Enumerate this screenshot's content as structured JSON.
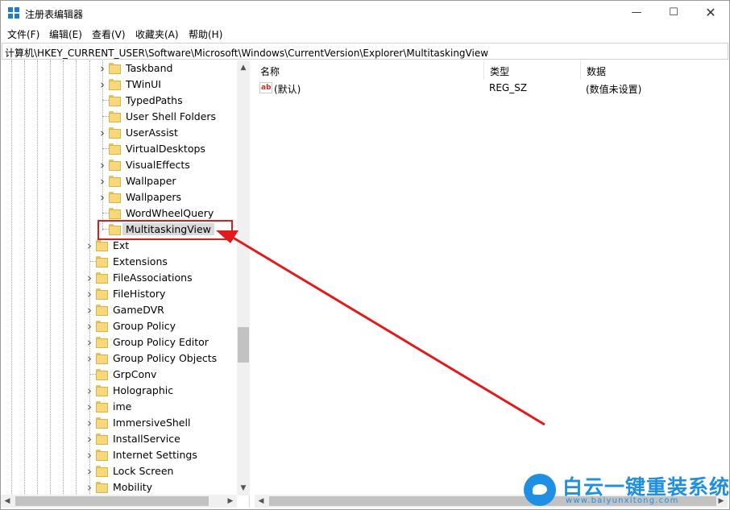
{
  "window": {
    "title": "注册表编辑器"
  },
  "menu": [
    "文件(F)",
    "编辑(E)",
    "查看(V)",
    "收藏夹(A)",
    "帮助(H)"
  ],
  "address": "计算机\\HKEY_CURRENT_USER\\Software\\Microsoft\\Windows\\CurrentVersion\\Explorer\\MultitaskingView",
  "tree": [
    {
      "label": "Taskband",
      "expandable": true,
      "level": 2
    },
    {
      "label": "TWinUI",
      "expandable": true,
      "level": 2
    },
    {
      "label": "TypedPaths",
      "expandable": false,
      "level": 2
    },
    {
      "label": "User Shell Folders",
      "expandable": false,
      "level": 2
    },
    {
      "label": "UserAssist",
      "expandable": true,
      "level": 2
    },
    {
      "label": "VirtualDesktops",
      "expandable": false,
      "level": 2
    },
    {
      "label": "VisualEffects",
      "expandable": true,
      "level": 2
    },
    {
      "label": "Wallpaper",
      "expandable": true,
      "level": 2
    },
    {
      "label": "Wallpapers",
      "expandable": true,
      "level": 2
    },
    {
      "label": "WordWheelQuery",
      "expandable": false,
      "level": 2
    },
    {
      "label": "MultitaskingView",
      "expandable": false,
      "level": 2,
      "selected": true
    },
    {
      "label": "Ext",
      "expandable": true,
      "level": 1
    },
    {
      "label": "Extensions",
      "expandable": false,
      "level": 1
    },
    {
      "label": "FileAssociations",
      "expandable": true,
      "level": 1
    },
    {
      "label": "FileHistory",
      "expandable": true,
      "level": 1
    },
    {
      "label": "GameDVR",
      "expandable": true,
      "level": 1
    },
    {
      "label": "Group Policy",
      "expandable": true,
      "level": 1
    },
    {
      "label": "Group Policy Editor",
      "expandable": true,
      "level": 1
    },
    {
      "label": "Group Policy Objects",
      "expandable": true,
      "level": 1
    },
    {
      "label": "GrpConv",
      "expandable": false,
      "level": 1
    },
    {
      "label": "Holographic",
      "expandable": true,
      "level": 1
    },
    {
      "label": "ime",
      "expandable": true,
      "level": 1
    },
    {
      "label": "ImmersiveShell",
      "expandable": true,
      "level": 1
    },
    {
      "label": "InstallService",
      "expandable": true,
      "level": 1
    },
    {
      "label": "Internet Settings",
      "expandable": true,
      "level": 1
    },
    {
      "label": "Lock Screen",
      "expandable": true,
      "level": 1
    },
    {
      "label": "Mobility",
      "expandable": true,
      "level": 1
    }
  ],
  "list": {
    "columns": [
      "名称",
      "类型",
      "数据"
    ],
    "rows": [
      {
        "icon": "string-value-icon",
        "name": "(默认)",
        "type": "REG_SZ",
        "data": "(数值未设置)"
      }
    ]
  },
  "watermark": {
    "title": "白云一键重装系统",
    "url": "www.baiyunxitong.com"
  },
  "colors": {
    "annotation": "#e11b1b",
    "accent": "#1f8fe3",
    "folder": "#f6d77a"
  }
}
